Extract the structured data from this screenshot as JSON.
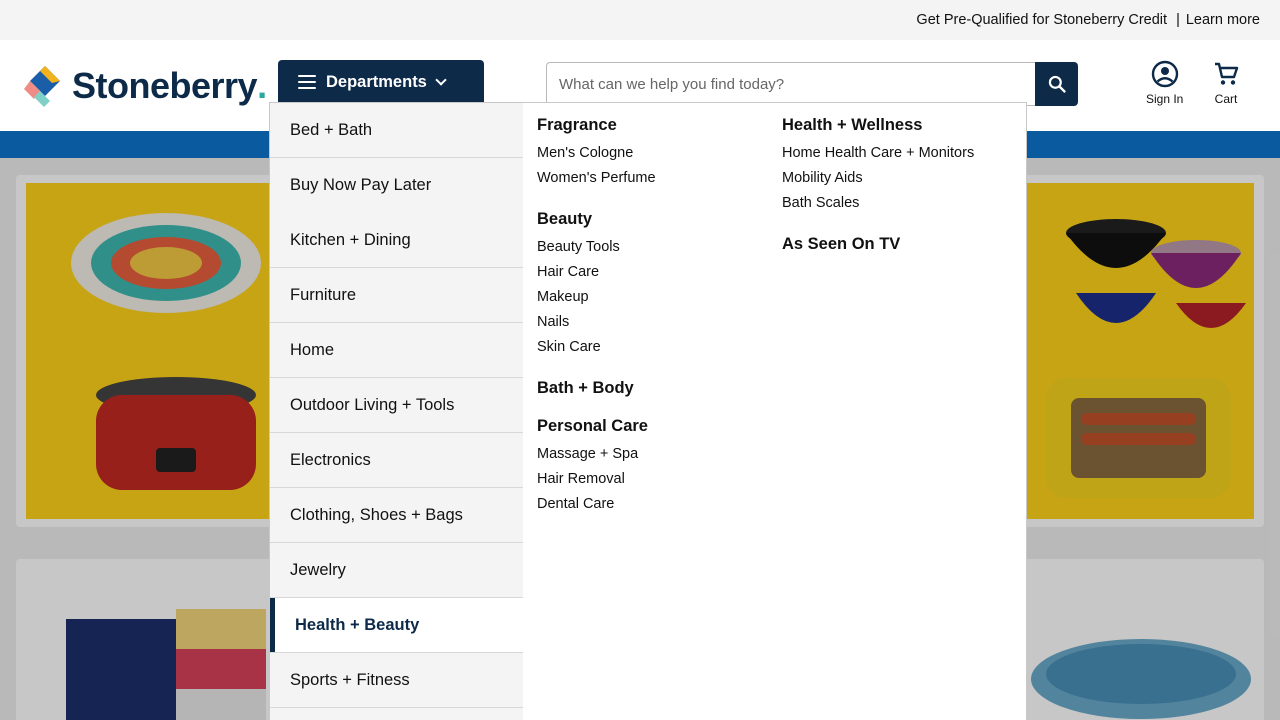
{
  "promo": {
    "text": "Get Pre-Qualified for Stoneberry Credit",
    "separator": "|",
    "link": "Learn more"
  },
  "header": {
    "logo_text": "Stoneberry",
    "departments_label": "Departments",
    "search_placeholder": "What can we help you find today?",
    "sign_in_label": "Sign In",
    "cart_label": "Cart"
  },
  "colors": {
    "brand_navy": "#0d2a48",
    "band_blue": "#0a5aa0",
    "hero_yellow": "#ffd21a"
  },
  "icons": {
    "menu": "hamburger-icon",
    "dropdown": "chevron-down-icon",
    "search": "search-icon",
    "account": "account-circle-icon",
    "cart": "cart-icon"
  },
  "departments": [
    {
      "label": "Bed + Bath"
    },
    {
      "label": "Buy Now Pay Later"
    },
    {
      "label": "Kitchen + Dining"
    },
    {
      "label": "Furniture"
    },
    {
      "label": "Home"
    },
    {
      "label": "Outdoor Living + Tools"
    },
    {
      "label": "Electronics"
    },
    {
      "label": "Clothing, Shoes + Bags"
    },
    {
      "label": "Jewelry"
    },
    {
      "label": "Health + Beauty",
      "active": true
    },
    {
      "label": "Sports + Fitness"
    }
  ],
  "submenu": {
    "col1": [
      {
        "heading": "Fragrance",
        "links": [
          "Men's Cologne",
          "Women's Perfume"
        ]
      },
      {
        "heading": "Beauty",
        "links": [
          "Beauty Tools",
          "Hair Care",
          "Makeup",
          "Nails",
          "Skin Care"
        ]
      },
      {
        "heading": "Bath + Body",
        "links": []
      },
      {
        "heading": "Personal Care",
        "links": [
          "Massage + Spa",
          "Hair Removal",
          "Dental Care"
        ]
      }
    ],
    "col2": [
      {
        "heading": "Health + Wellness",
        "links": [
          "Home Health Care + Monitors",
          "Mobility Aids",
          "Bath Scales"
        ]
      },
      {
        "heading": "As Seen On TV",
        "links": []
      }
    ]
  }
}
